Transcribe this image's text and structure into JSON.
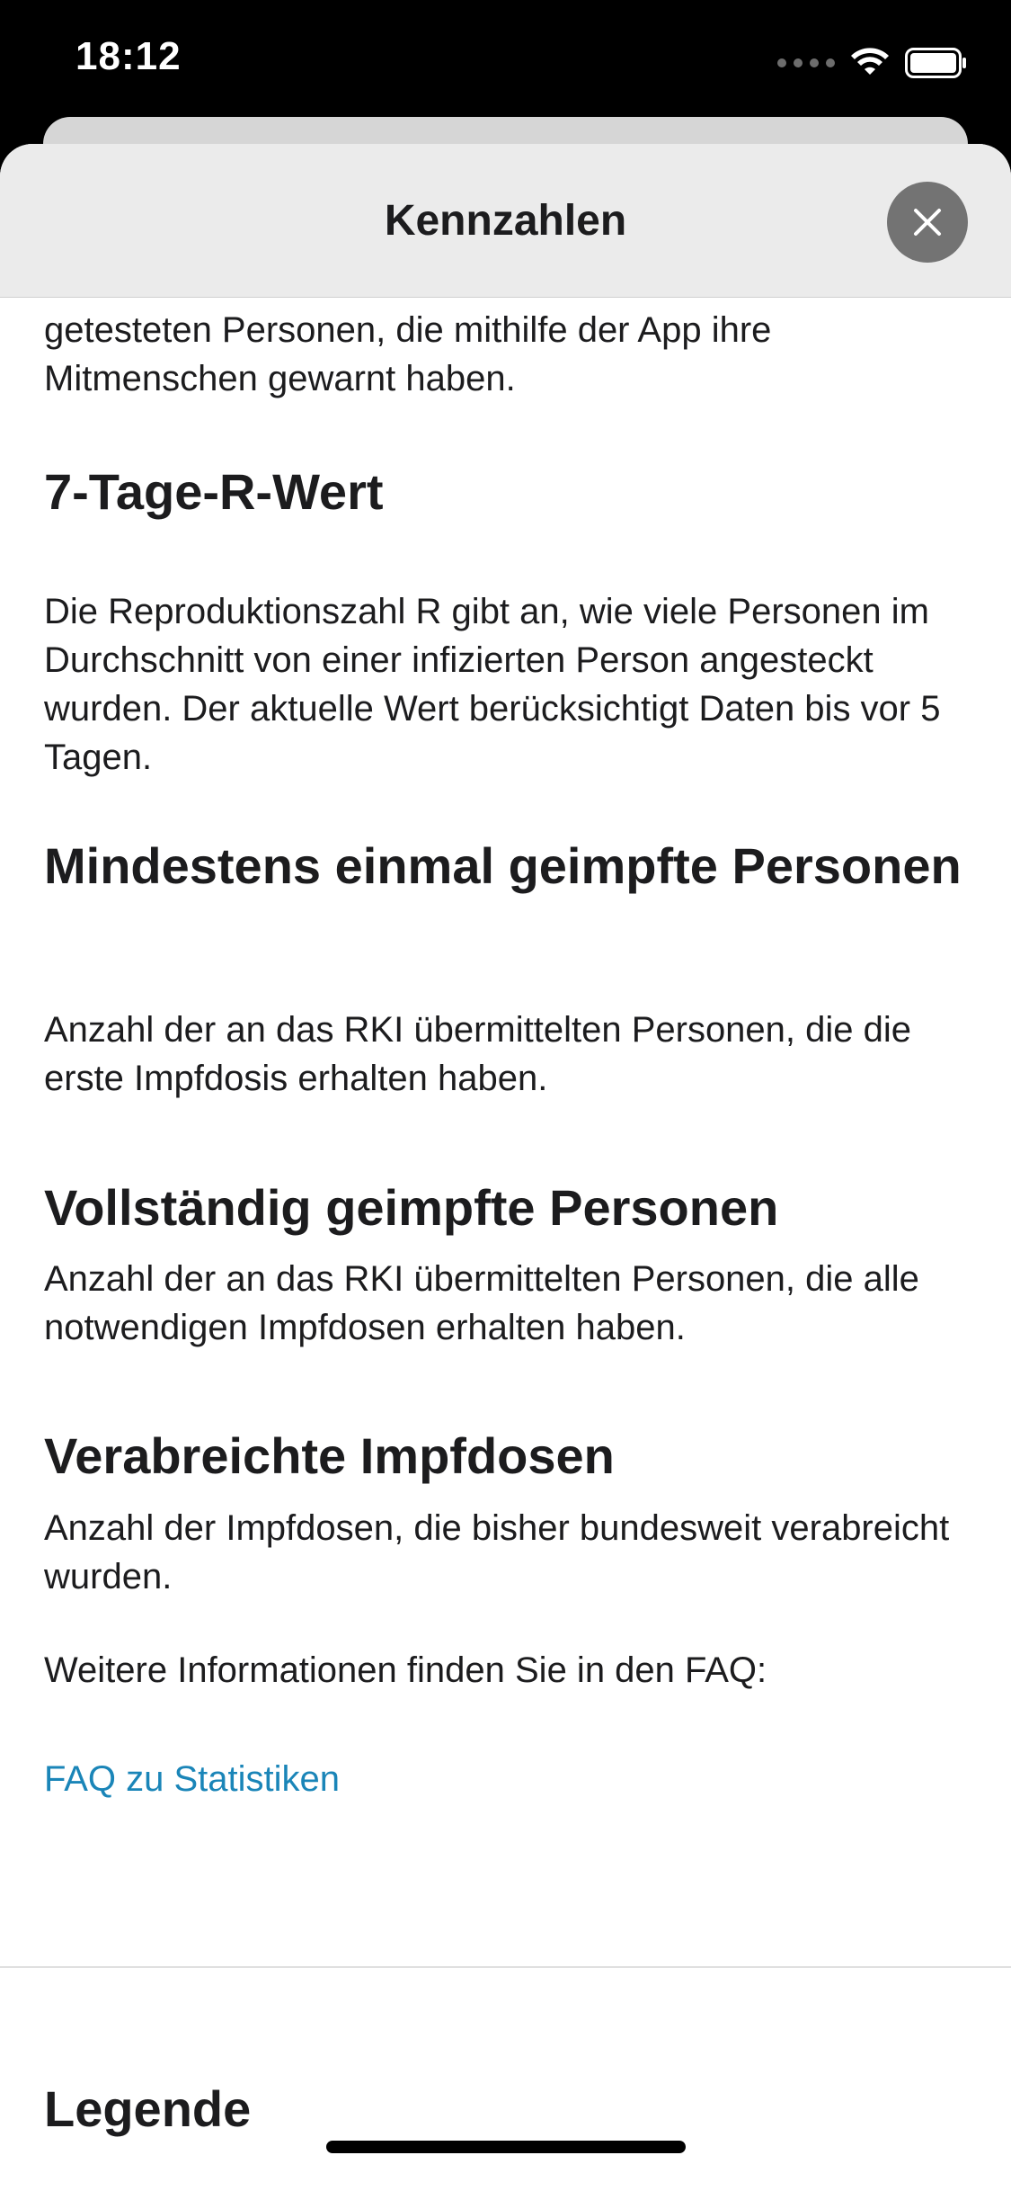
{
  "status_bar": {
    "time": "18:12"
  },
  "sheet": {
    "title": "Kennzahlen",
    "close_icon": "close-icon"
  },
  "content": {
    "partial_first_line": "Personen, die mithilfe der App ihre",
    "partial_paragraph": "getesteten Personen, die mithilfe der App ihre Mitmenschen gewarnt haben.",
    "sections": [
      {
        "heading": "7-Tage-R-Wert",
        "text": "Die Reproduktionszahl R gibt an, wie viele Personen im Durchschnitt von einer infizierten Person angesteckt wurden. Der aktuelle Wert berücksichtigt Daten bis vor 5 Tagen."
      },
      {
        "heading": "Mindestens einmal geimpfte Personen",
        "text": "Anzahl der an das RKI übermittelten Personen, die die erste Impfdosis erhalten haben."
      },
      {
        "heading": "Vollständig geimpfte Personen",
        "text": "Anzahl der an das RKI übermittelten Personen, die alle notwendigen Impfdosen erhalten haben."
      },
      {
        "heading": "Verabreichte Impfdosen",
        "text": "Anzahl der Impfdosen, die bisher bundesweit verabreicht wurden."
      }
    ],
    "faq_intro": "Weitere Informationen finden Sie in den FAQ:",
    "faq_link": "FAQ zu Statistiken",
    "legend_heading": "Legende"
  },
  "colors": {
    "link": "#1a85b8",
    "header_bg": "#ebebeb",
    "close_button_bg": "#737373"
  }
}
